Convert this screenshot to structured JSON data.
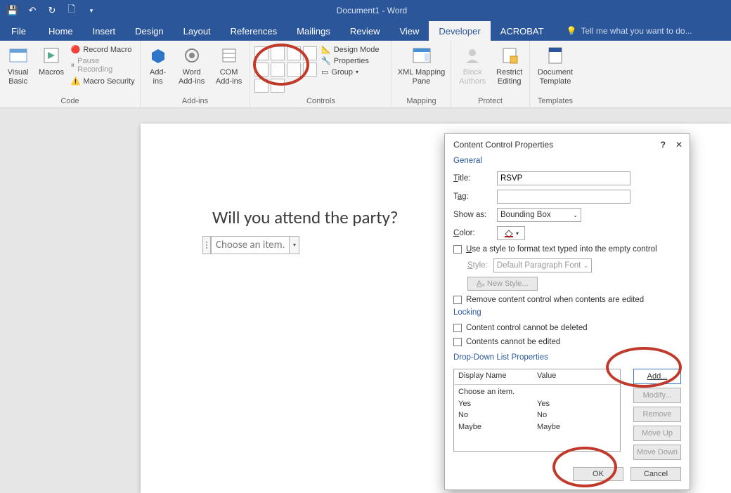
{
  "title": "Document1 - Word",
  "qat": {
    "save": "save-icon",
    "undo": "undo-icon",
    "repeat": "repeat-icon",
    "new": "new-doc-icon",
    "customize": "▾"
  },
  "tabs": [
    "File",
    "Home",
    "Insert",
    "Design",
    "Layout",
    "References",
    "Mailings",
    "Review",
    "View",
    "Developer",
    "ACROBAT"
  ],
  "active_tab": "Developer",
  "tell_me": "Tell me what you want to do...",
  "ribbon": {
    "code": {
      "label": "Code",
      "visual_basic": "Visual\nBasic",
      "macros": "Macros",
      "record": "Record Macro",
      "pause": "Pause Recording",
      "security": "Macro Security"
    },
    "addins": {
      "label": "Add-ins",
      "addins": "Add-\nins",
      "word": "Word\nAdd-ins",
      "com": "COM\nAdd-ins"
    },
    "controls": {
      "label": "Controls",
      "design": "Design Mode",
      "properties": "Properties",
      "group": "Group"
    },
    "mapping": {
      "label": "Mapping",
      "pane": "XML Mapping\nPane"
    },
    "protect": {
      "label": "Protect",
      "block": "Block\nAuthors",
      "restrict": "Restrict\nEditing"
    },
    "templates": {
      "label": "Templates",
      "doc": "Document\nTemplate"
    }
  },
  "document": {
    "heading": "Will you attend the party?",
    "cc_placeholder": "Choose an item."
  },
  "dialog": {
    "title": "Content Control Properties",
    "help": "?",
    "close": "✕",
    "general": "General",
    "title_label": "Title:",
    "title_value": "RSVP",
    "tag_label": "Tag:",
    "tag_value": "",
    "showas_label": "Show as:",
    "showas_value": "Bounding Box",
    "color_label": "Color:",
    "use_style": "Use a style to format text typed into the empty control",
    "style_label": "Style:",
    "style_value": "Default Paragraph Font",
    "new_style": "New Style...",
    "remove_cc": "Remove content control when contents are edited",
    "locking": "Locking",
    "lock_delete": "Content control cannot be deleted",
    "lock_edit": "Contents cannot be edited",
    "dd_label": "Drop-Down List Properties",
    "col_display": "Display Name",
    "col_value": "Value",
    "items": [
      {
        "display": "Choose an item.",
        "value": ""
      },
      {
        "display": "Yes",
        "value": "Yes"
      },
      {
        "display": "No",
        "value": "No"
      },
      {
        "display": "Maybe",
        "value": "Maybe"
      }
    ],
    "add": "Add...",
    "modify": "Modify...",
    "remove": "Remove",
    "moveup": "Move Up",
    "movedown": "Move Down",
    "ok": "OK",
    "cancel": "Cancel"
  }
}
